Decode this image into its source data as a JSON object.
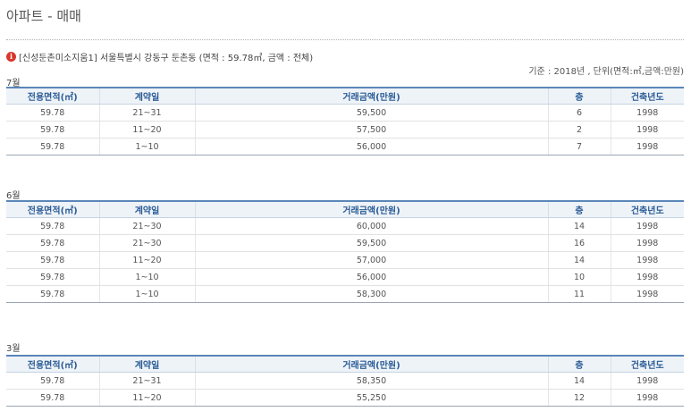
{
  "page": {
    "title": "아파트 - 매매"
  },
  "info": {
    "icon": "info-icon",
    "text": "[신성둔촌미소지움1] 서울특별시 강동구 둔촌동 (면적 : 59.78㎡, 금액 : 전체)"
  },
  "criteria": "기준 : 2018년 , 단위(면적:㎡,금액:만원)",
  "columns": [
    "전용면적(㎡)",
    "계약일",
    "거래금액(만원)",
    "층",
    "건축년도"
  ],
  "sections": [
    {
      "month": "7월",
      "rows": [
        [
          "59.78",
          "21~31",
          "59,500",
          "6",
          "1998"
        ],
        [
          "59.78",
          "11~20",
          "57,500",
          "2",
          "1998"
        ],
        [
          "59.78",
          "1~10",
          "56,000",
          "7",
          "1998"
        ]
      ]
    },
    {
      "month": "6월",
      "rows": [
        [
          "59.78",
          "21~30",
          "60,000",
          "14",
          "1998"
        ],
        [
          "59.78",
          "21~30",
          "59,500",
          "16",
          "1998"
        ],
        [
          "59.78",
          "11~20",
          "57,000",
          "14",
          "1998"
        ],
        [
          "59.78",
          "1~10",
          "56,000",
          "10",
          "1998"
        ],
        [
          "59.78",
          "1~10",
          "58,300",
          "11",
          "1998"
        ]
      ]
    },
    {
      "month": "3월",
      "rows": [
        [
          "59.78",
          "21~31",
          "58,350",
          "14",
          "1998"
        ],
        [
          "59.78",
          "11~20",
          "55,250",
          "12",
          "1998"
        ]
      ]
    }
  ]
}
